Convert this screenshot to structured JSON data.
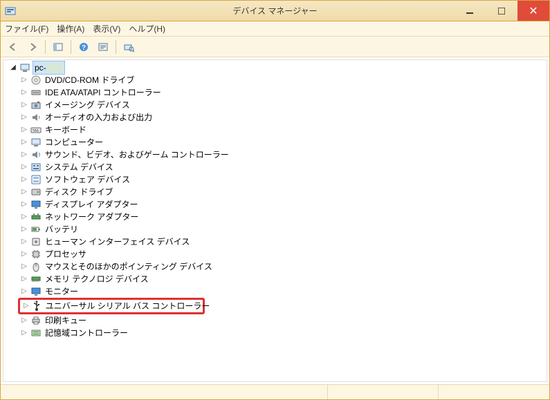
{
  "window": {
    "title": "デバイス マネージャー"
  },
  "menu": {
    "file": "ファイル(F)",
    "action": "操作(A)",
    "view": "表示(V)",
    "help": "ヘルプ(H)"
  },
  "tree": {
    "root_label": "pc-",
    "items": [
      {
        "icon": "disc",
        "label": "DVD/CD-ROM ドライブ"
      },
      {
        "icon": "ide",
        "label": "IDE ATA/ATAPI コントローラー"
      },
      {
        "icon": "imaging",
        "label": "イメージング デバイス"
      },
      {
        "icon": "audio",
        "label": "オーディオの入力および出力"
      },
      {
        "icon": "keyboard",
        "label": "キーボード"
      },
      {
        "icon": "computer",
        "label": "コンピューター"
      },
      {
        "icon": "sound",
        "label": "サウンド、ビデオ、およびゲーム コントローラー"
      },
      {
        "icon": "system",
        "label": "システム デバイス"
      },
      {
        "icon": "software",
        "label": "ソフトウェア デバイス"
      },
      {
        "icon": "disk",
        "label": "ディスク ドライブ"
      },
      {
        "icon": "display",
        "label": "ディスプレイ アダプター"
      },
      {
        "icon": "network",
        "label": "ネットワーク アダプター"
      },
      {
        "icon": "battery",
        "label": "バッテリ"
      },
      {
        "icon": "hid",
        "label": "ヒューマン インターフェイス デバイス"
      },
      {
        "icon": "cpu",
        "label": "プロセッサ"
      },
      {
        "icon": "mouse",
        "label": "マウスとそのほかのポインティング デバイス"
      },
      {
        "icon": "memory",
        "label": "メモリ テクノロジ デバイス"
      },
      {
        "icon": "monitor",
        "label": "モニター"
      },
      {
        "icon": "usb",
        "label": "ユニバーサル シリアル バス コントローラー",
        "highlighted": true
      },
      {
        "icon": "print",
        "label": "印刷キュー"
      },
      {
        "icon": "storage",
        "label": "記憶域コントローラー"
      }
    ]
  }
}
